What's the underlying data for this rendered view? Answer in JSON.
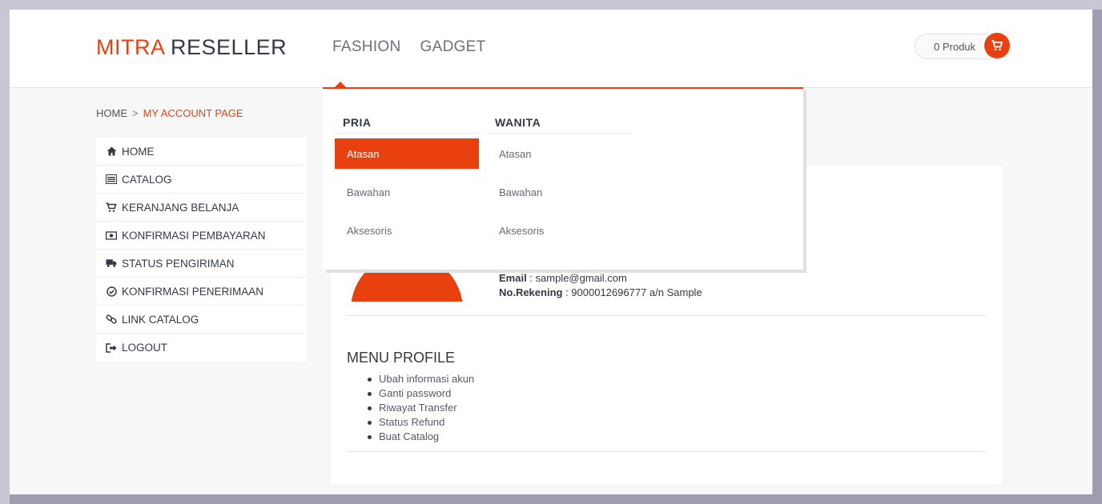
{
  "header": {
    "logo_part1": "MITRA",
    "logo_part2": "RESELLER",
    "nav": [
      "FASHION",
      "GADGET"
    ],
    "cart_label": "0 Produk",
    "accent_color": "#e8410f"
  },
  "breadcrumb": {
    "home": "HOME",
    "separator": ">",
    "current": "MY ACCOUNT PAGE"
  },
  "sidebar": {
    "items": [
      {
        "label": "HOME",
        "icon": "home-icon"
      },
      {
        "label": "CATALOG",
        "icon": "list-icon"
      },
      {
        "label": "KERANJANG BELANJA",
        "icon": "cart-icon"
      },
      {
        "label": "KONFIRMASI PEMBAYARAN",
        "icon": "money-icon"
      },
      {
        "label": "STATUS PENGIRIMAN",
        "icon": "truck-icon"
      },
      {
        "label": "KONFIRMASI PENERIMAAN",
        "icon": "check-circle-icon"
      },
      {
        "label": "LINK CATALOG",
        "icon": "link-icon"
      },
      {
        "label": "LOGOUT",
        "icon": "sign-out-icon"
      }
    ]
  },
  "dropdown": {
    "columns": [
      {
        "heading": "PRIA",
        "items": [
          "Atasan",
          "Bawahan",
          "Aksesoris"
        ],
        "active": "Atasan"
      },
      {
        "heading": "WANITA",
        "items": [
          "Atasan",
          "Bawahan",
          "Aksesoris"
        ]
      }
    ]
  },
  "profile": {
    "email_label": "Email",
    "email_value": " : sample@gmail.com",
    "rekening_label": "No.Rekening",
    "rekening_value": " : 9000012696777 a/n Sample"
  },
  "menu_profile": {
    "title": "MENU PROFILE",
    "items": [
      "Ubah informasi akun",
      "Ganti password",
      "Riwayat Transfer",
      "Status Refund",
      "Buat Catalog"
    ]
  }
}
